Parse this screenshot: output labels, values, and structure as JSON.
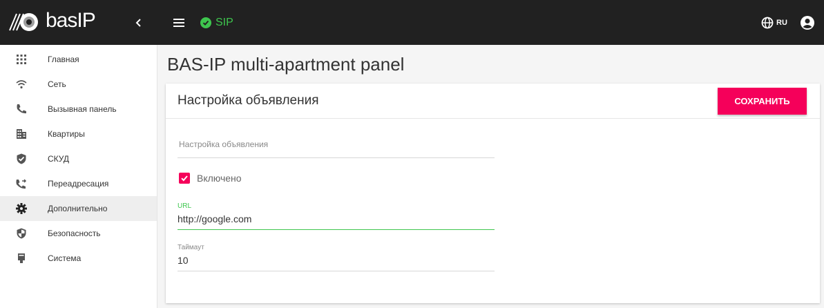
{
  "header": {
    "logo_text": "basIP",
    "sip_label": "SIP",
    "language": "RU"
  },
  "colors": {
    "accent": "#f5005a",
    "status_ok": "#3ec64e",
    "topbar": "#212121"
  },
  "sidebar": {
    "items": [
      {
        "label": "Главная",
        "icon": "grid-icon"
      },
      {
        "label": "Сеть",
        "icon": "wifi-icon"
      },
      {
        "label": "Вызывная панель",
        "icon": "phone-icon"
      },
      {
        "label": "Квартиры",
        "icon": "building-icon"
      },
      {
        "label": "СКУД",
        "icon": "shield-check-icon"
      },
      {
        "label": "Переадресация",
        "icon": "phone-forward-icon"
      },
      {
        "label": "Дополнительно",
        "icon": "gear-icon",
        "active": true
      },
      {
        "label": "Безопасность",
        "icon": "security-shield-icon"
      },
      {
        "label": "Система",
        "icon": "device-icon"
      }
    ]
  },
  "main": {
    "page_title": "BAS-IP multi-apartment panel",
    "card_title": "Настройка объявления",
    "save_label": "СОХРАНИТЬ",
    "announcement_placeholder": "Настройка объявления",
    "enabled_label": "Включено",
    "enabled": true,
    "url_label": "URL",
    "url_value": "http://google.com",
    "timeout_label": "Таймаут",
    "timeout_value": "10"
  }
}
